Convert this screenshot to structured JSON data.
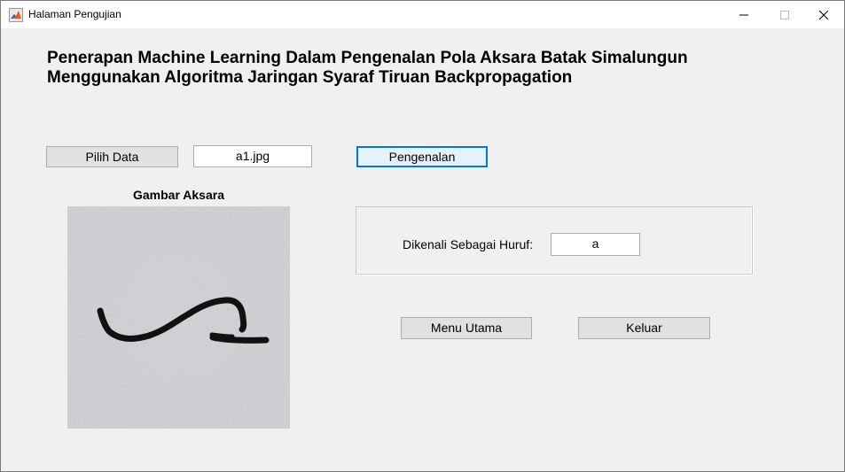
{
  "window": {
    "title": "Halaman Pengujian"
  },
  "header": {
    "line1": "Penerapan Machine Learning Dalam Pengenalan Pola Aksara Batak Simalungun",
    "line2": "Menggunakan Algoritma Jaringan Syaraf Tiruan Backpropagation"
  },
  "controls": {
    "pilih_data_label": "Pilih Data",
    "filename_value": "a1.jpg",
    "pengenalan_label": "Pengenalan"
  },
  "image_panel": {
    "title": "Gambar Aksara"
  },
  "result": {
    "label": "Dikenali Sebagai Huruf:",
    "value": "a"
  },
  "footer_buttons": {
    "menu_utama_label": "Menu Utama",
    "keluar_label": "Keluar"
  },
  "icons": [
    "matlab-app-icon",
    "minimize-icon",
    "maximize-icon",
    "close-icon"
  ]
}
